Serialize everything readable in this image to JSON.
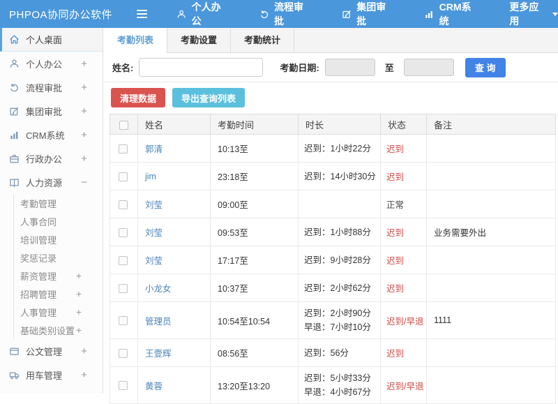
{
  "topbar": {
    "title": "PHPOA协同办公软件",
    "menu_icon": "hamburger-icon",
    "nav": [
      {
        "label": "个人办公",
        "icon": "person-icon"
      },
      {
        "label": "流程审批",
        "icon": "workflow-icon"
      },
      {
        "label": "集团审批",
        "icon": "edit-icon"
      },
      {
        "label": "CRM系统",
        "icon": "bar-chart-icon"
      },
      {
        "label": "更多应用",
        "icon": "caret-down-icon"
      }
    ]
  },
  "sidebar": {
    "items": [
      {
        "label": "个人桌面",
        "icon": "home-icon",
        "active": true
      },
      {
        "label": "个人办公",
        "icon": "person-icon",
        "expand": "+"
      },
      {
        "label": "流程审批",
        "icon": "workflow-icon",
        "expand": "+"
      },
      {
        "label": "集团审批",
        "icon": "edit-icon",
        "expand": "+"
      },
      {
        "label": "CRM系统",
        "icon": "bar-chart-icon",
        "expand": "+"
      },
      {
        "label": "行政办公",
        "icon": "briefcase-icon",
        "expand": "+"
      },
      {
        "label": "人力资源",
        "icon": "book-icon",
        "expand": "−",
        "children": [
          {
            "label": "考勤管理"
          },
          {
            "label": "人事合同"
          },
          {
            "label": "培训管理"
          },
          {
            "label": "奖惩记录"
          },
          {
            "label": "薪资管理",
            "expand": "+"
          },
          {
            "label": "招聘管理",
            "expand": "+"
          },
          {
            "label": "人事管理",
            "expand": "+"
          },
          {
            "label": "基础类别设置",
            "expand": "+"
          }
        ]
      },
      {
        "label": "公文管理",
        "icon": "document-icon",
        "expand": "+"
      },
      {
        "label": "用车管理",
        "icon": "truck-icon",
        "expand": "+"
      }
    ]
  },
  "tabs": [
    {
      "label": "考勤列表",
      "active": true
    },
    {
      "label": "考勤设置",
      "active": false
    },
    {
      "label": "考勤统计",
      "active": false
    }
  ],
  "filter": {
    "name_label": "姓名:",
    "name_value": "",
    "date_label": "考勤日期:",
    "date_from": "",
    "to_label": "至",
    "date_to": "",
    "search_button": "查 询"
  },
  "actions": {
    "clean_button": "清理数据",
    "export_button": "导出查询列表"
  },
  "table": {
    "headers": {
      "name": "姓名",
      "time": "考勤时间",
      "duration": "时长",
      "status": "状态",
      "remark": "备注"
    },
    "rows": [
      {
        "name": "郭清",
        "time": "10:13至",
        "duration": "迟到：1小时22分",
        "status": "迟到",
        "remark": ""
      },
      {
        "name": "jim",
        "time": "23:18至",
        "duration": "迟到：14小时30分",
        "status": "迟到",
        "remark": ""
      },
      {
        "name": "刘莹",
        "time": "09:00至",
        "duration": "",
        "status": "正常",
        "remark": ""
      },
      {
        "name": "刘莹",
        "time": "09:53至",
        "duration": "迟到：1小时88分",
        "status": "迟到",
        "remark": "业务需要外出"
      },
      {
        "name": "刘莹",
        "time": "17:17至",
        "duration": "迟到：9小时28分",
        "status": "迟到",
        "remark": ""
      },
      {
        "name": "小龙女",
        "time": "10:37至",
        "duration": "迟到：2小时62分",
        "status": "迟到",
        "remark": ""
      },
      {
        "name": "管理员",
        "time": "10:54至10:54",
        "duration": "迟到：2小时90分\n早退：7小时10分",
        "status": "迟到/早退",
        "remark": "1111"
      },
      {
        "name": "王壹辉",
        "time": "08:56至",
        "duration": "迟到：56分",
        "status": "迟到",
        "remark": ""
      },
      {
        "name": "黄蓉",
        "time": "13:20至13:20",
        "duration": "迟到：5小时33分\n早退：4小时67分",
        "status": "迟到/早退",
        "remark": ""
      }
    ]
  },
  "colors": {
    "topbar_blue": "#4a97db",
    "search_button_blue": "#4183e6",
    "danger_red": "#d9534f",
    "info_cyan": "#5bc0de",
    "link_blue": "#4a84bb",
    "status_red": "#d14a44",
    "active_tab_text": "#5e9fd4"
  }
}
